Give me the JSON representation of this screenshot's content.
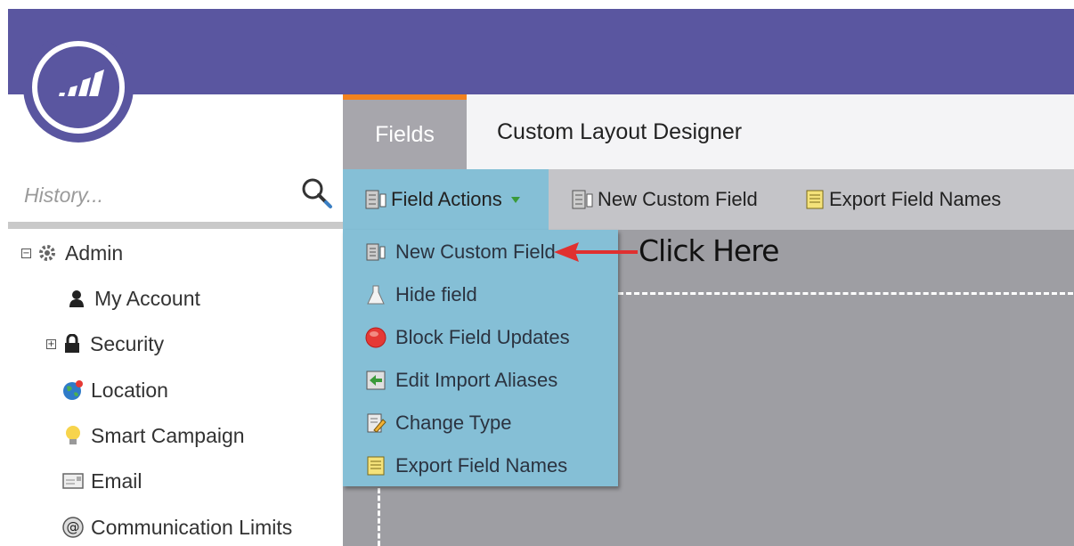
{
  "colors": {
    "header_bg": "#5a56a0",
    "tab_active_accent": "#f2821f",
    "menu_bg": "#85bfd6",
    "annotation_arrow": "#e03030"
  },
  "logo": {
    "icon": "marketo-logo"
  },
  "search": {
    "placeholder": "History...",
    "icon": "search-icon"
  },
  "sidebar": {
    "items": [
      {
        "label": "Admin",
        "icon": "gear-icon",
        "expander": "⊟"
      },
      {
        "label": "My Account",
        "icon": "user-icon"
      },
      {
        "label": "Security",
        "icon": "lock-icon",
        "expander": "⊞"
      },
      {
        "label": "Location",
        "icon": "globe-icon"
      },
      {
        "label": "Smart Campaign",
        "icon": "lightbulb-icon"
      },
      {
        "label": "Email",
        "icon": "email-icon"
      },
      {
        "label": "Communication Limits",
        "icon": "at-sign-icon"
      }
    ]
  },
  "tabs": [
    {
      "label": "Fields",
      "active": true
    },
    {
      "label": "Custom Layout Designer",
      "active": false
    }
  ],
  "toolbar": {
    "field_actions": "Field Actions",
    "new_custom_field": "New Custom Field",
    "export_field_names": "Export Field Names"
  },
  "menu": {
    "items": [
      {
        "label": "New Custom Field",
        "icon": "database-icon"
      },
      {
        "label": "Hide field",
        "icon": "flask-icon"
      },
      {
        "label": "Block Field Updates",
        "icon": "red-dot-icon"
      },
      {
        "label": "Edit Import Aliases",
        "icon": "import-icon"
      },
      {
        "label": "Change Type",
        "icon": "edit-doc-icon"
      },
      {
        "label": "Export Field Names",
        "icon": "spreadsheet-icon"
      }
    ]
  },
  "annotation": {
    "text": "Click Here"
  }
}
